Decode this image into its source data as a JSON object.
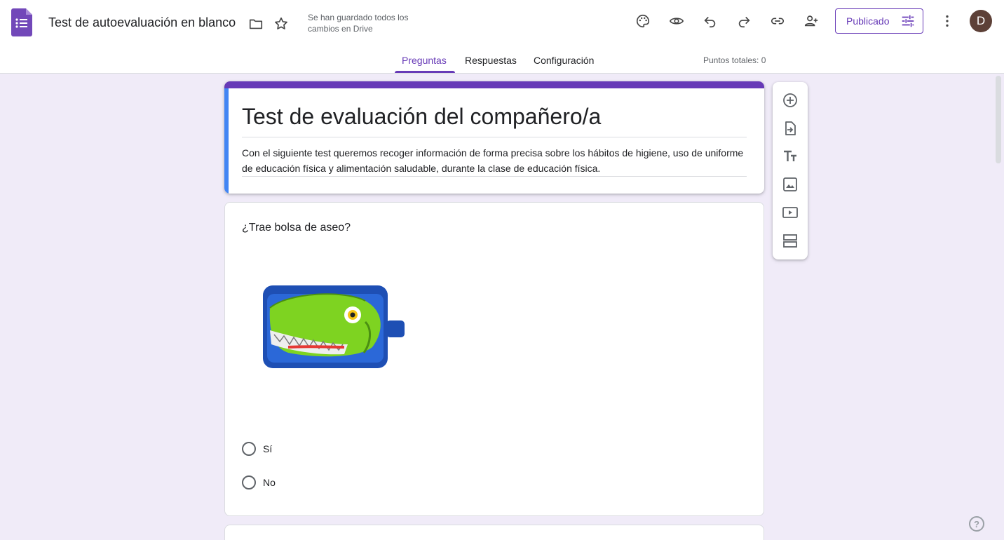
{
  "header": {
    "doc_title": "Test de autoevaluación en blanco",
    "save_status": "Se han guardado todos los cambios en Drive",
    "publish_label": "Publicado",
    "avatar_initial": "D",
    "accent_color": "#673ab7",
    "icons": [
      "folder-icon",
      "star-icon",
      "palette-icon",
      "eye-icon",
      "undo-icon",
      "redo-icon",
      "link-icon",
      "add-person-icon",
      "tune-icon",
      "more-vert-icon"
    ]
  },
  "tabs": {
    "items": [
      {
        "label": "Preguntas",
        "active": true
      },
      {
        "label": "Respuestas",
        "active": false
      },
      {
        "label": "Configuración",
        "active": false
      }
    ],
    "points": "Puntos totales: 0"
  },
  "form": {
    "title": "Test de evaluación del compañero/a",
    "description": "Con el siguiente test queremos recoger información de forma precisa sobre los hábitos de higiene, uso de uniforme de educación física y alimentación saludable, durante la clase de educación física."
  },
  "question": {
    "title": "¿Trae bolsa de aseo?",
    "options": [
      "Sí",
      "No"
    ]
  },
  "toolbar": {
    "tools": [
      "add-question-icon",
      "import-questions-icon",
      "add-title-icon",
      "add-image-icon",
      "add-video-icon",
      "add-section-icon"
    ]
  },
  "help": "?"
}
